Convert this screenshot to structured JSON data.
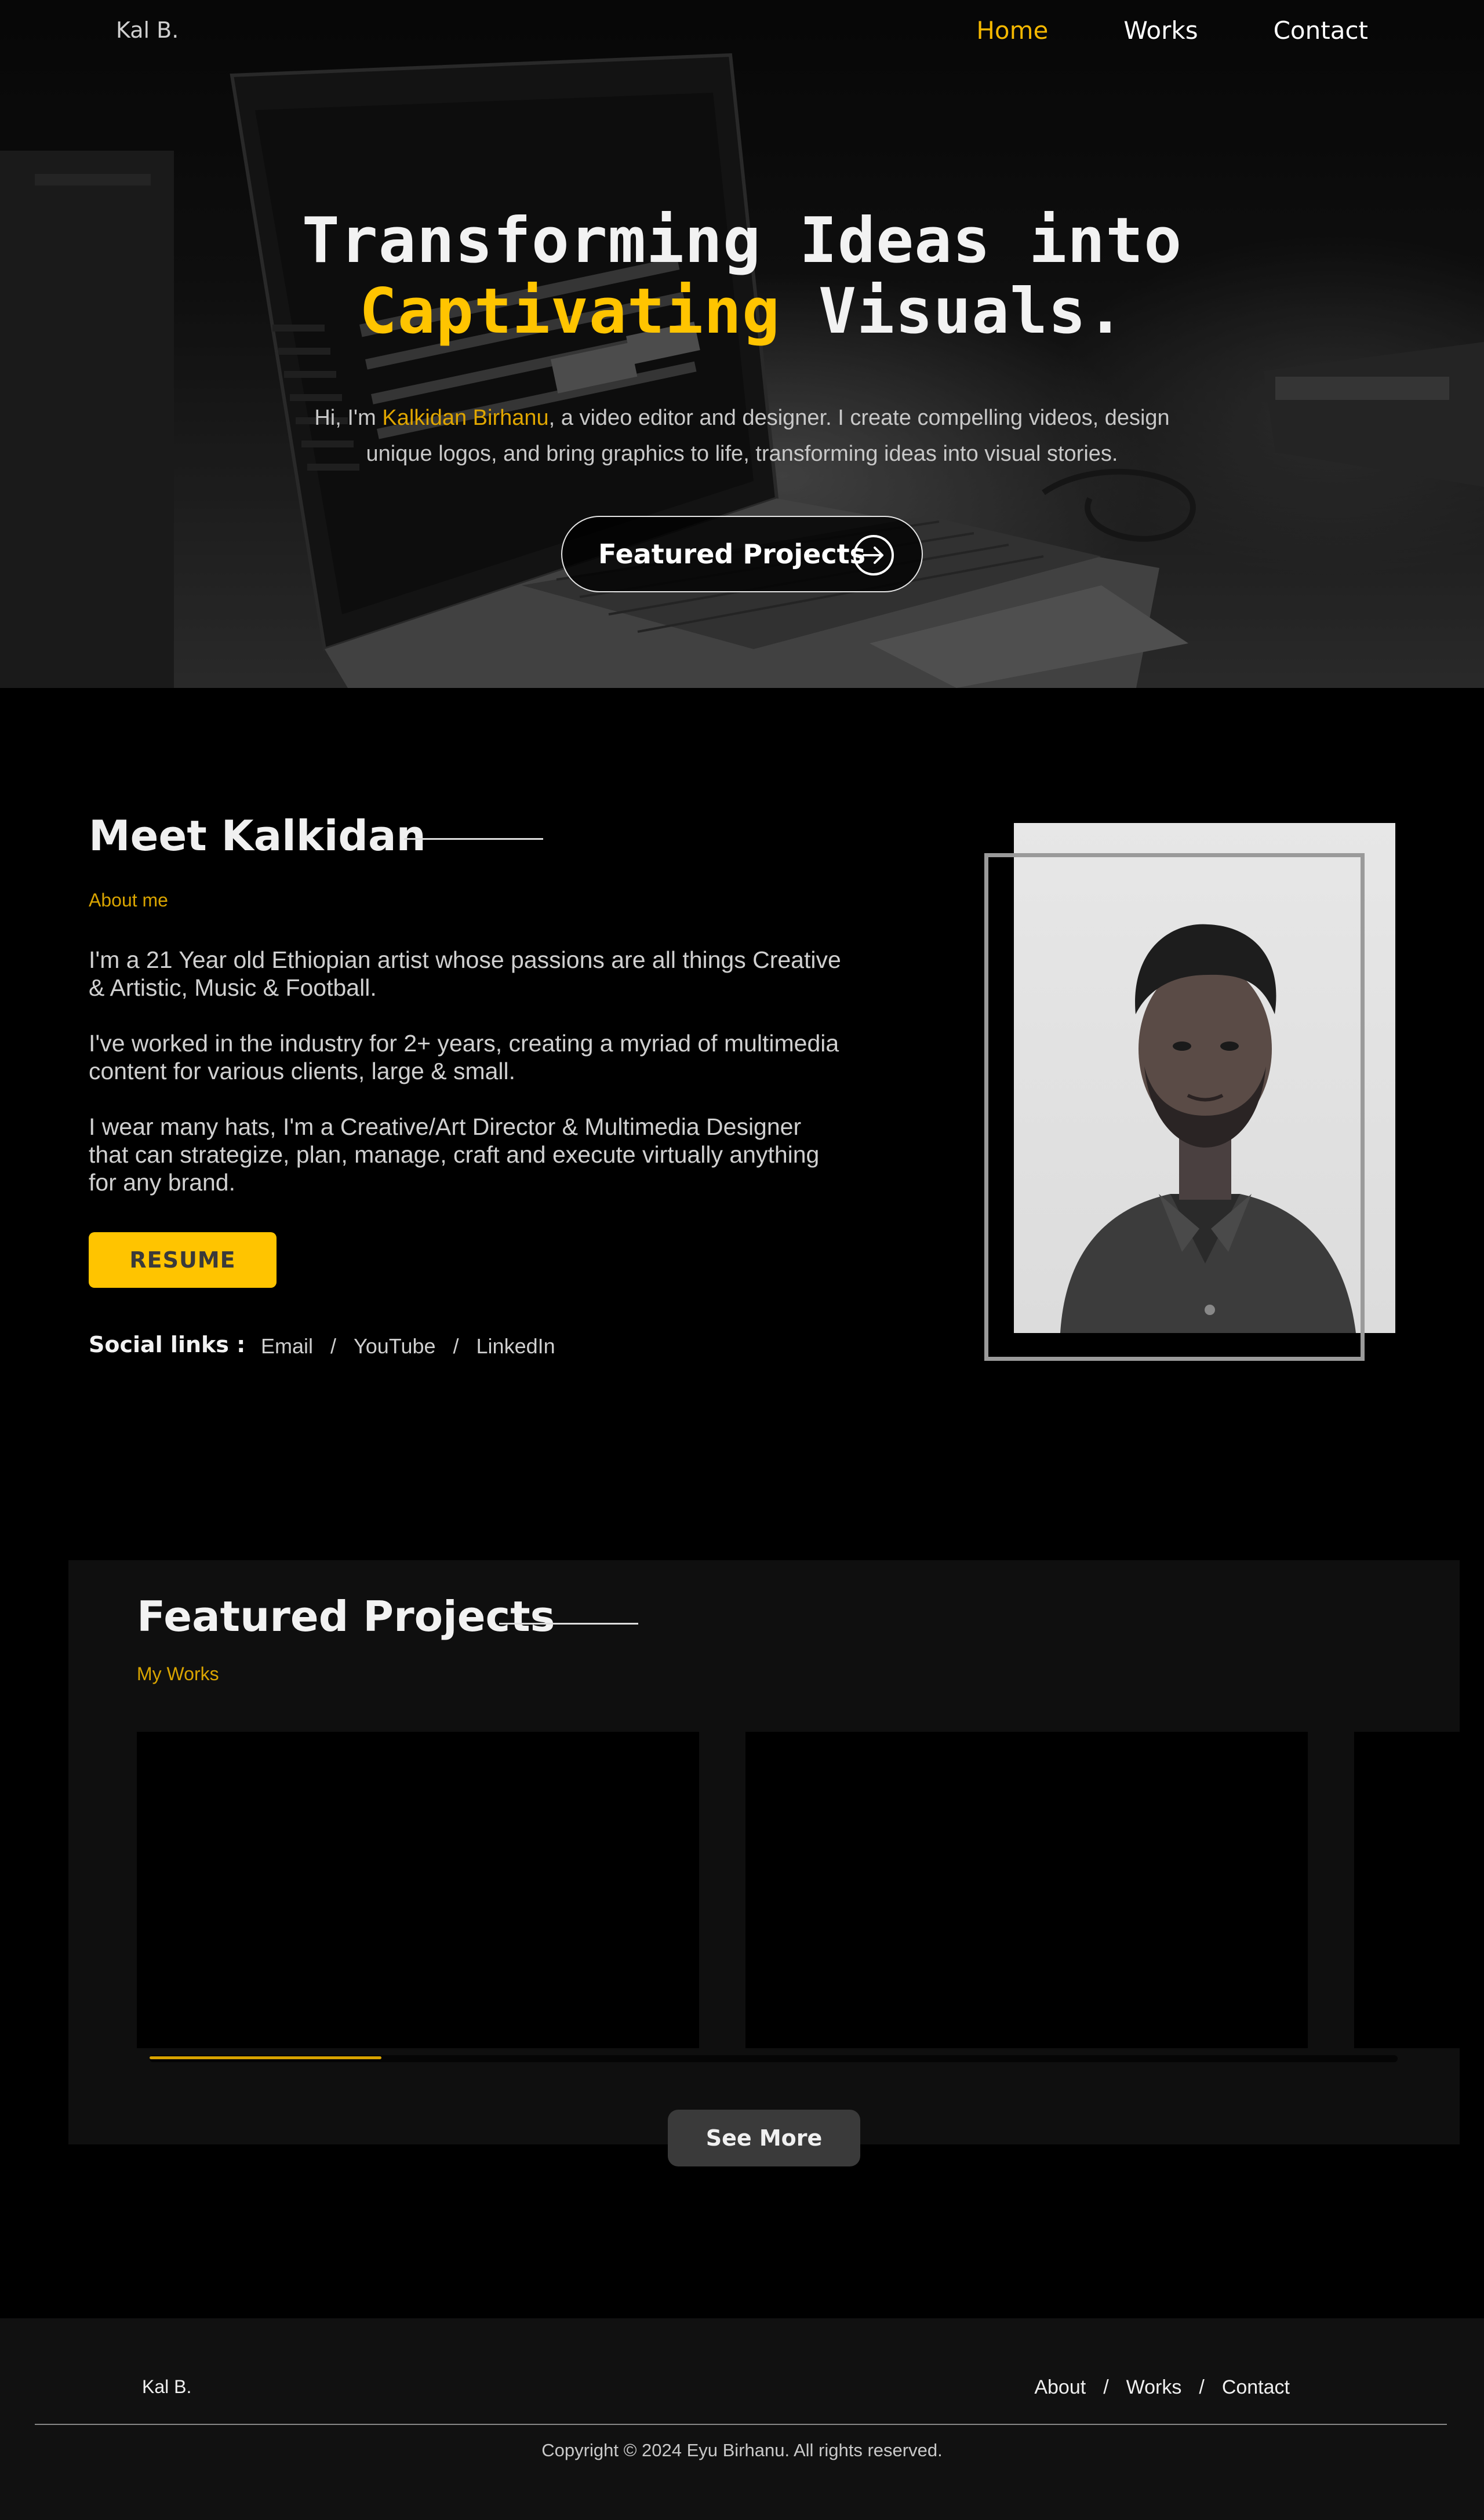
{
  "nav": {
    "brand": "Kal B.",
    "links": [
      {
        "label": "Home",
        "active": true
      },
      {
        "label": "Works",
        "active": false
      },
      {
        "label": "Contact",
        "active": false
      }
    ]
  },
  "hero": {
    "title_line1": "Transforming Ideas into",
    "title_accent": "Captivating",
    "title_rest": " Visuals.",
    "sub_prefix": "Hi, I'm ",
    "sub_name": "Kalkidan Birhanu",
    "sub_suffix": ", a video editor and designer. I create compelling videos, design unique logos, and bring graphics to life, transforming ideas into visual stories.",
    "cta_label": "Featured Projects",
    "cta_icon": "arrow-right-circle-icon"
  },
  "about": {
    "title": "Meet Kalkidan",
    "kicker": "About me",
    "paragraphs": [
      "I'm a 21 Year old Ethiopian artist whose passions are all things Creative & Artistic, Music & Football.",
      "I've worked in the industry for 2+ years, creating a myriad of multimedia content for various clients, large & small.",
      "I wear many hats, I'm a Creative/Art Director & Multimedia Designer that can strategize, plan, manage, craft and execute virtually anything for any brand."
    ],
    "resume_label": "RESUME",
    "social_label": "Social links :",
    "social_links": [
      "Email",
      "YouTube",
      "LinkedIn"
    ],
    "separator": "/"
  },
  "projects": {
    "title": "Featured Projects",
    "kicker": "My Works",
    "see_more_label": "See More"
  },
  "footer": {
    "brand": "Kal B.",
    "links": [
      "About",
      "Works",
      "Contact"
    ],
    "separator": "/",
    "copyright": "Copyright © 2024 Eyu Birhanu. All rights reserved."
  },
  "colors": {
    "accent": "#ffc400",
    "background": "#000000",
    "panel": "#0f0f0f"
  }
}
